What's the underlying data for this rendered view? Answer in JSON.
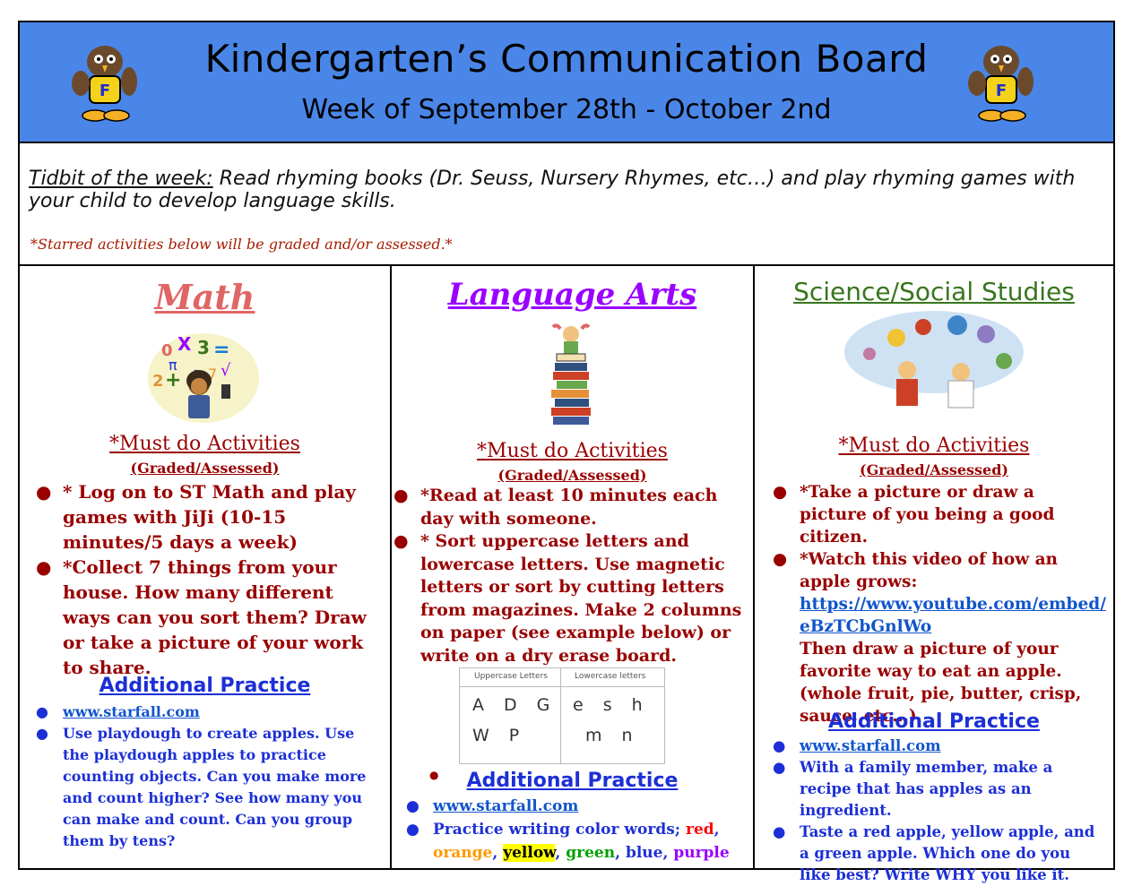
{
  "header": {
    "title": "Kindergarten’s Communication Board",
    "subtitle": "Week of September 28th - October 2nd"
  },
  "tidbit": {
    "label": "Tidbit of the week:",
    "text": " Read rhyming books (Dr. Seuss, Nursery Rhymes, etc…) and play rhyming games with your child to develop language skills.",
    "starred_note": "*Starred activities below will be graded and/or assessed.*"
  },
  "common": {
    "must_do": "*Must do Activities",
    "graded": "(Graded/Assessed)",
    "additional": "Additional Practice",
    "bullet": "●"
  },
  "math": {
    "title": "Math",
    "must_items": [
      "* Log on to ST Math and play games with JiJi (10-15 minutes/5 days a week)",
      "*Collect 7 things from your house. How many different ways can you sort them? Draw or take a picture of your work to share."
    ],
    "add_link": "www.starfall.com",
    "add_item": "Use playdough to create  apples. Use the playdough apples to practice counting objects. Can you make more and count higher? See how many you can make and count. Can you group them by tens?"
  },
  "language_arts": {
    "title": "Language Arts",
    "must_items": [
      "*Read at least 10 minutes each day with someone.",
      "* Sort uppercase letters and lowercase letters. Use magnetic letters or sort by cutting letters from magazines. Make 2 columns on paper (see example below) or write on a dry erase board."
    ],
    "example": {
      "upper_header": "Uppercase Letters",
      "lower_header": "Lowercase letters",
      "upper_row1": "ADG",
      "upper_row2": "WP",
      "lower_row1": "esh",
      "lower_row2": "mn"
    },
    "add_link": "www.starfall.com",
    "color_prefix": "Practice writing color words; ",
    "colors": {
      "red": "red",
      "orange": "orange",
      "yellow": "yellow",
      "green": "green",
      "blue": "blue",
      "purple": "purple"
    },
    "comma": ", "
  },
  "science": {
    "title": "Science/Social Studies",
    "must_item1": "*Take a picture or draw a picture of you being a good citizen.",
    "must_item2_a": "*Watch this video of how an apple grows:",
    "must_item2_link": "https://www.youtube.com/embed/eBzTCbGnlWo",
    "must_item2_b": "Then draw a picture of your favorite way to eat an apple. (whole fruit, pie, butter, crisp, sauce, etc…)",
    "add_link": "www.starfall.com",
    "add_items": [
      "With a family member, make a recipe that has apples as an ingredient.",
      "Taste a red apple, yellow apple, and a green apple. Which one do you like best? Write WHY you like it."
    ]
  }
}
